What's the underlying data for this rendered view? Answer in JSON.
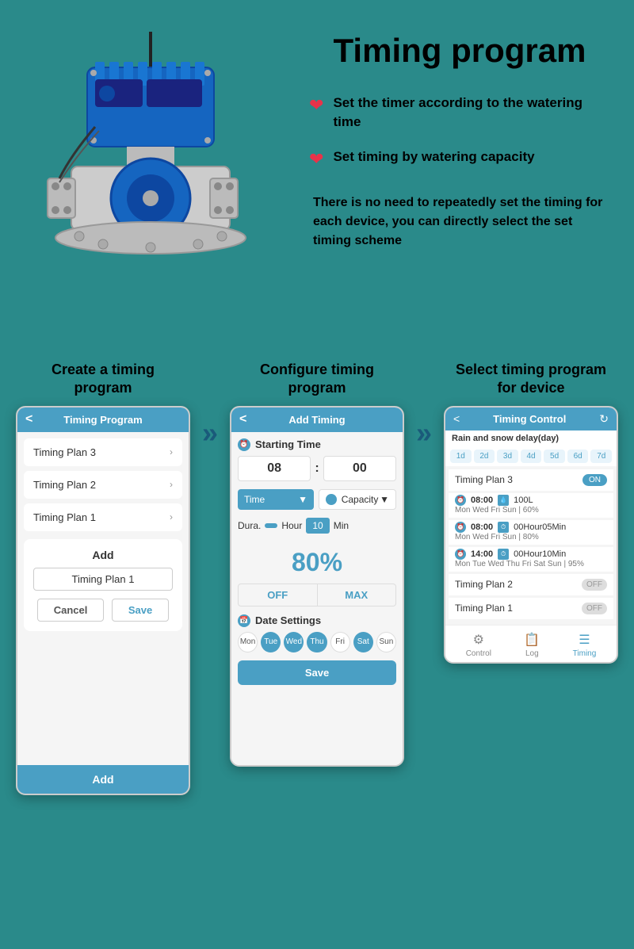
{
  "page": {
    "title": "Timing program",
    "background_color": "#2a8a8a"
  },
  "header": {
    "title": "Timing program"
  },
  "features": [
    {
      "icon": "heart",
      "text": "Set the timer according to the watering time"
    },
    {
      "icon": "heart",
      "text": "Set timing by watering capacity"
    }
  ],
  "description": "There is no need to repeatedly set the timing for each device, you can directly select the set timing scheme",
  "phone1": {
    "header": "Timing Program",
    "items": [
      "Timing Plan 3",
      "Timing Plan 2",
      "Timing Plan 1"
    ],
    "dialog_title": "Add",
    "dialog_input": "Timing Plan 1",
    "cancel_label": "Cancel",
    "save_label": "Save",
    "footer_label": "Add",
    "column_label": "Create a timing\nprogram"
  },
  "phone2": {
    "header": "Add Timing",
    "starting_time_label": "Starting Time",
    "hour": "08",
    "minute": "00",
    "time_label": "Time",
    "capacity_label": "Capacity",
    "dura_label": "Dura.",
    "hour_label": "Hour",
    "min_label": "Min",
    "min_value": "10",
    "percent": "80%",
    "off_label": "OFF",
    "max_label": "MAX",
    "date_settings_label": "Date Settings",
    "days": [
      "Mon",
      "Tue",
      "Wed",
      "Thu",
      "Fri",
      "Sat",
      "Sun"
    ],
    "active_days": [
      "Tue",
      "Wed",
      "Thu",
      "Sat"
    ],
    "save_label": "Save",
    "column_label": "Configure timing\nprogram"
  },
  "phone3": {
    "header": "Timing Control",
    "refresh_icon": "↻",
    "rain_delay_label": "Rain and snow delay(day)",
    "day_tabs": [
      "1d",
      "2d",
      "3d",
      "4d",
      "5d",
      "6d",
      "7d"
    ],
    "plan3_label": "Timing Plan 3",
    "plan3_toggle": "ON",
    "schedules": [
      {
        "time": "08:00",
        "amount": "100L",
        "days": "Mon Wed Fri Sun | 60%"
      },
      {
        "time": "08:00",
        "duration": "00Hour05Min",
        "days": "Mon Wed Fri Sun | 80%"
      },
      {
        "time": "14:00",
        "duration": "00Hour10Min",
        "days": "Mon Tue Wed Thu Fri Sat Sun | 95%"
      }
    ],
    "plan2_label": "Timing Plan 2",
    "plan2_toggle": "OFF",
    "plan1_label": "Timing Plan 1",
    "plan1_toggle": "OFF",
    "footer_tabs": [
      "Control",
      "Log",
      "Timing"
    ],
    "active_tab": "Timing",
    "column_label": "Select timing program\nfor device"
  },
  "arrows": {
    "symbol": "»"
  }
}
